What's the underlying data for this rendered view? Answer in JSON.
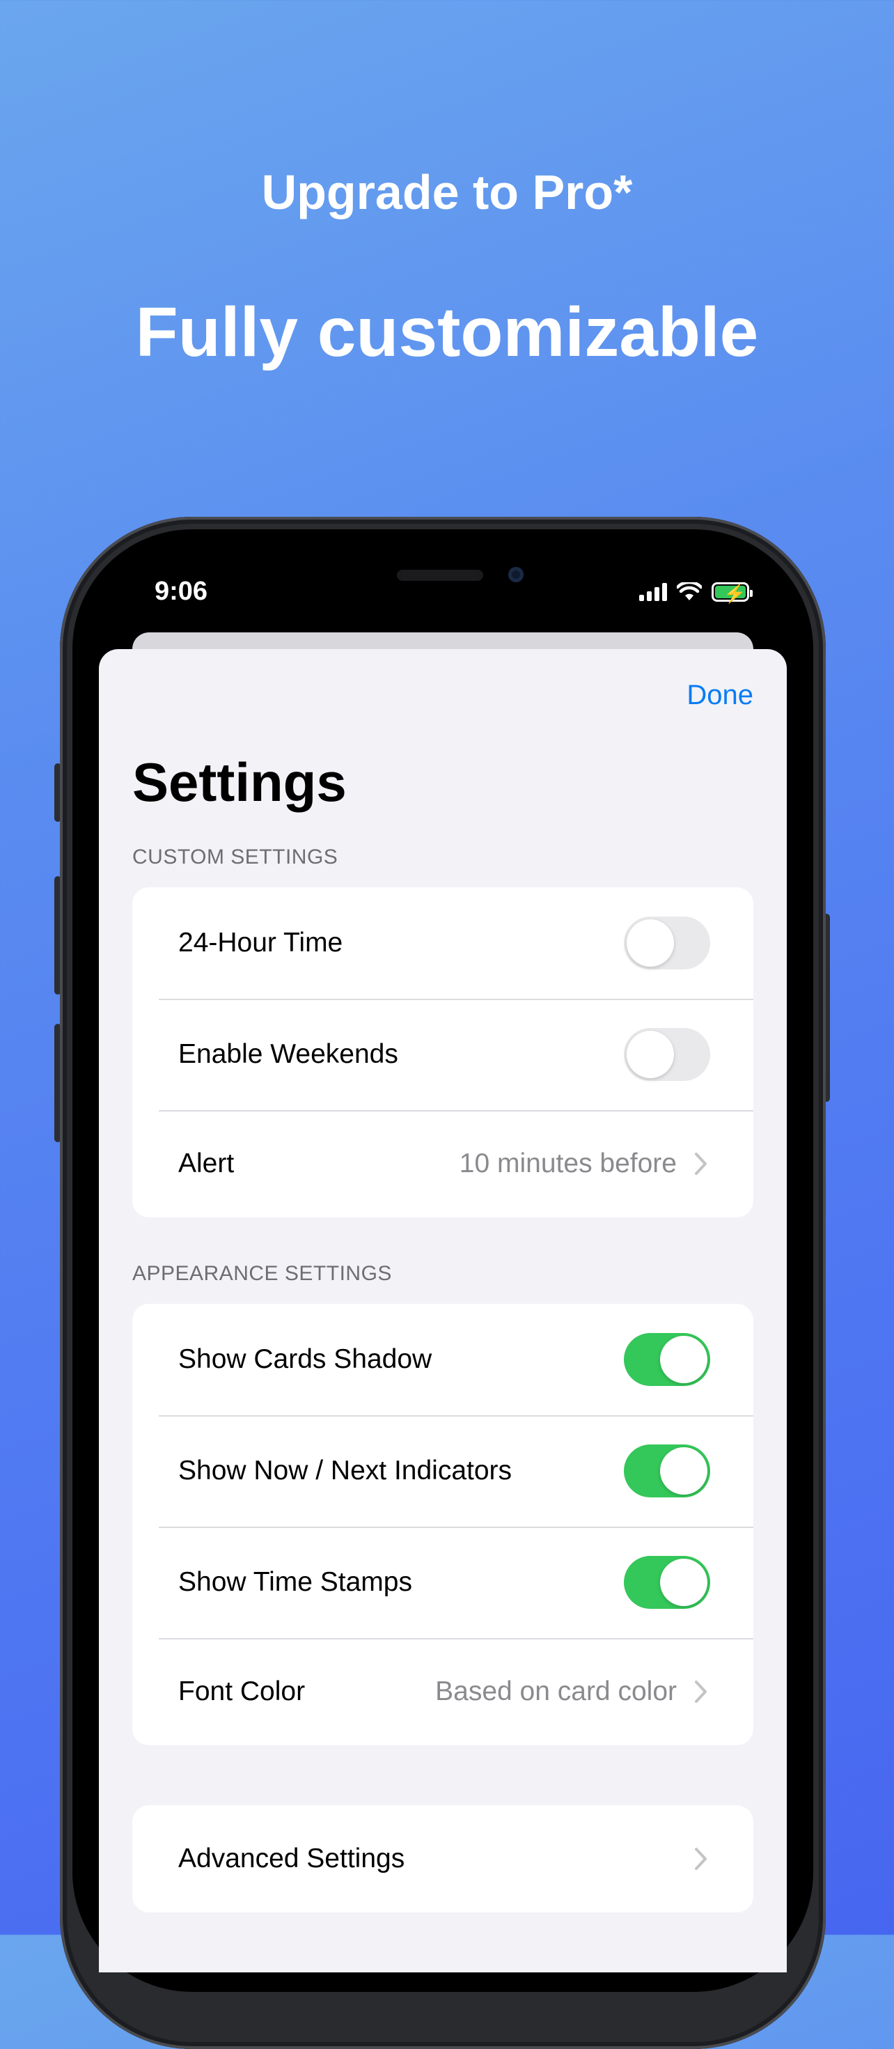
{
  "header": {
    "subtitle": "Upgrade to Pro*",
    "title": "Fully customizable"
  },
  "status_bar": {
    "time": "9:06",
    "battery_color": "#34c759"
  },
  "sheet": {
    "done_label": "Done",
    "title": "Settings"
  },
  "custom_settings": {
    "label": "CUSTOM SETTINGS",
    "rows": [
      {
        "label": "24-Hour Time",
        "on": false
      },
      {
        "label": "Enable Weekends",
        "on": false
      },
      {
        "label": "Alert",
        "value": "10 minutes before"
      }
    ]
  },
  "appearance_settings": {
    "label": "APPEARANCE SETTINGS",
    "rows": [
      {
        "label": "Show Cards Shadow",
        "on": true
      },
      {
        "label": "Show Now / Next Indicators",
        "on": true
      },
      {
        "label": "Show Time Stamps",
        "on": true
      },
      {
        "label": "Font Color",
        "value": "Based on card color"
      }
    ]
  },
  "advanced": {
    "label": "Advanced Settings"
  },
  "colors": {
    "accent": "#0a7cf5",
    "toggle_on": "#34c759",
    "toggle_off": "#e9e9eb"
  }
}
